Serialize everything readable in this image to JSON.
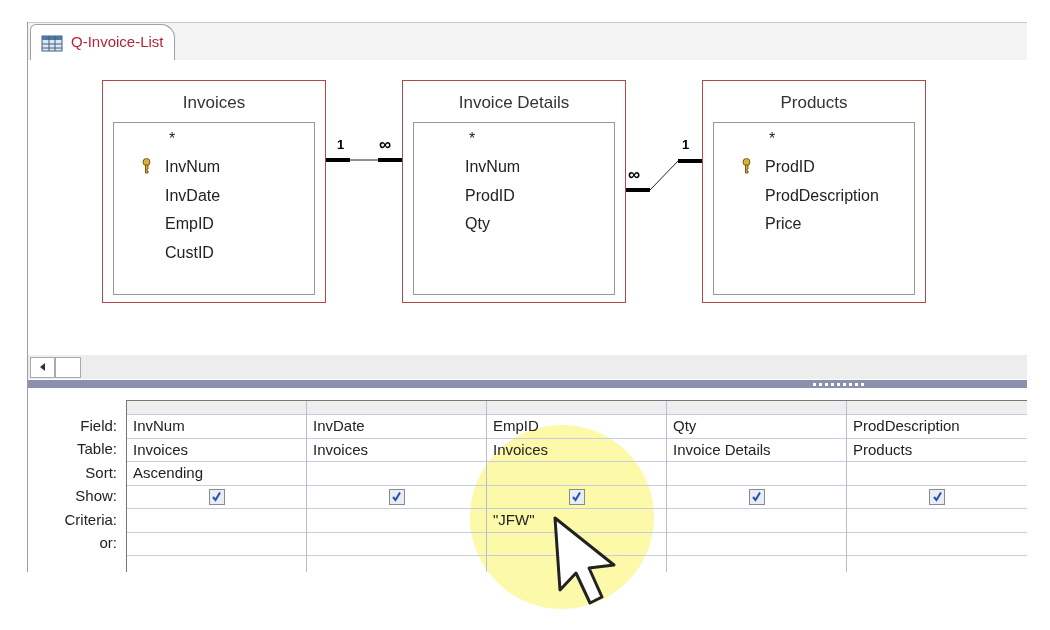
{
  "tab": {
    "title": "Q-Invoice-List",
    "selected": true
  },
  "tables": [
    {
      "name": "Invoices",
      "fields": [
        {
          "name": "*",
          "key": false
        },
        {
          "name": "InvNum",
          "key": true
        },
        {
          "name": "InvDate",
          "key": false
        },
        {
          "name": "EmpID",
          "key": false
        },
        {
          "name": "CustID",
          "key": false
        }
      ]
    },
    {
      "name": "Invoice Details",
      "fields": [
        {
          "name": "*",
          "key": false
        },
        {
          "name": "InvNum",
          "key": false
        },
        {
          "name": "ProdID",
          "key": false
        },
        {
          "name": "Qty",
          "key": false
        }
      ]
    },
    {
      "name": "Products",
      "fields": [
        {
          "name": "*",
          "key": false
        },
        {
          "name": "ProdID",
          "key": true
        },
        {
          "name": "ProdDescription",
          "key": false
        },
        {
          "name": "Price",
          "key": false
        }
      ]
    }
  ],
  "joins": [
    {
      "left_label": "1",
      "right_label": "∞"
    },
    {
      "left_label": "∞",
      "right_label": "1"
    }
  ],
  "grid": {
    "row_labels": [
      "Field:",
      "Table:",
      "Sort:",
      "Show:",
      "Criteria:",
      "or:"
    ],
    "columns": [
      {
        "field": "InvNum",
        "table": "Invoices",
        "sort": "Ascending",
        "show": true
      },
      {
        "field": "InvDate",
        "table": "Invoices",
        "show": true
      },
      {
        "field": "EmpID",
        "table": "Invoices",
        "show": true,
        "criteria": "\"JFW\""
      },
      {
        "field": "Qty",
        "table": "Invoice Details",
        "show": true
      },
      {
        "field": "ProdDescription",
        "table": "Products",
        "show": true
      }
    ]
  }
}
